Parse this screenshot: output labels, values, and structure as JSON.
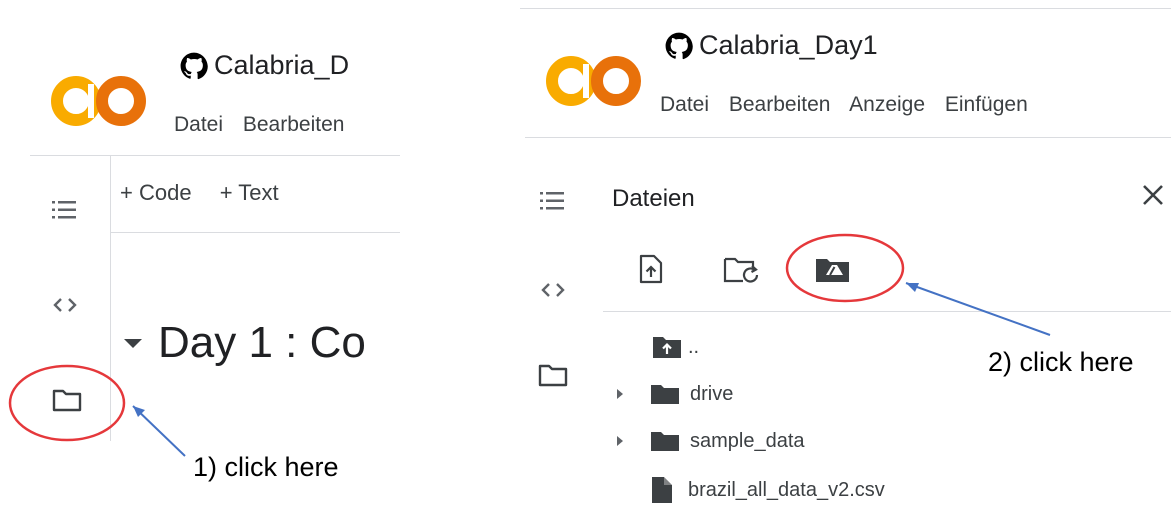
{
  "left_panel": {
    "logo_text": "CO",
    "notebook_title": "Calabria_D",
    "menu": [
      "Datei",
      "Bearbeiten"
    ],
    "toolbar": {
      "code_label": "+ Code",
      "text_label": "+ Text"
    },
    "heading": "Day 1 : Co"
  },
  "right_panel": {
    "logo_text": "CO",
    "notebook_title": "Calabria_Day1",
    "menu": [
      "Datei",
      "Bearbeiten",
      "Anzeige",
      "Einfügen"
    ],
    "files_panel": {
      "title": "Dateien",
      "parent_dir": "..",
      "items": [
        {
          "name": "drive",
          "type": "folder"
        },
        {
          "name": "sample_data",
          "type": "folder"
        },
        {
          "name": "brazil_all_data_v2.csv",
          "type": "file"
        }
      ]
    }
  },
  "annotations": {
    "step1": "1) click here",
    "step2": "2) click here",
    "color": "#e5383b",
    "arrow_color": "#4472c4"
  }
}
